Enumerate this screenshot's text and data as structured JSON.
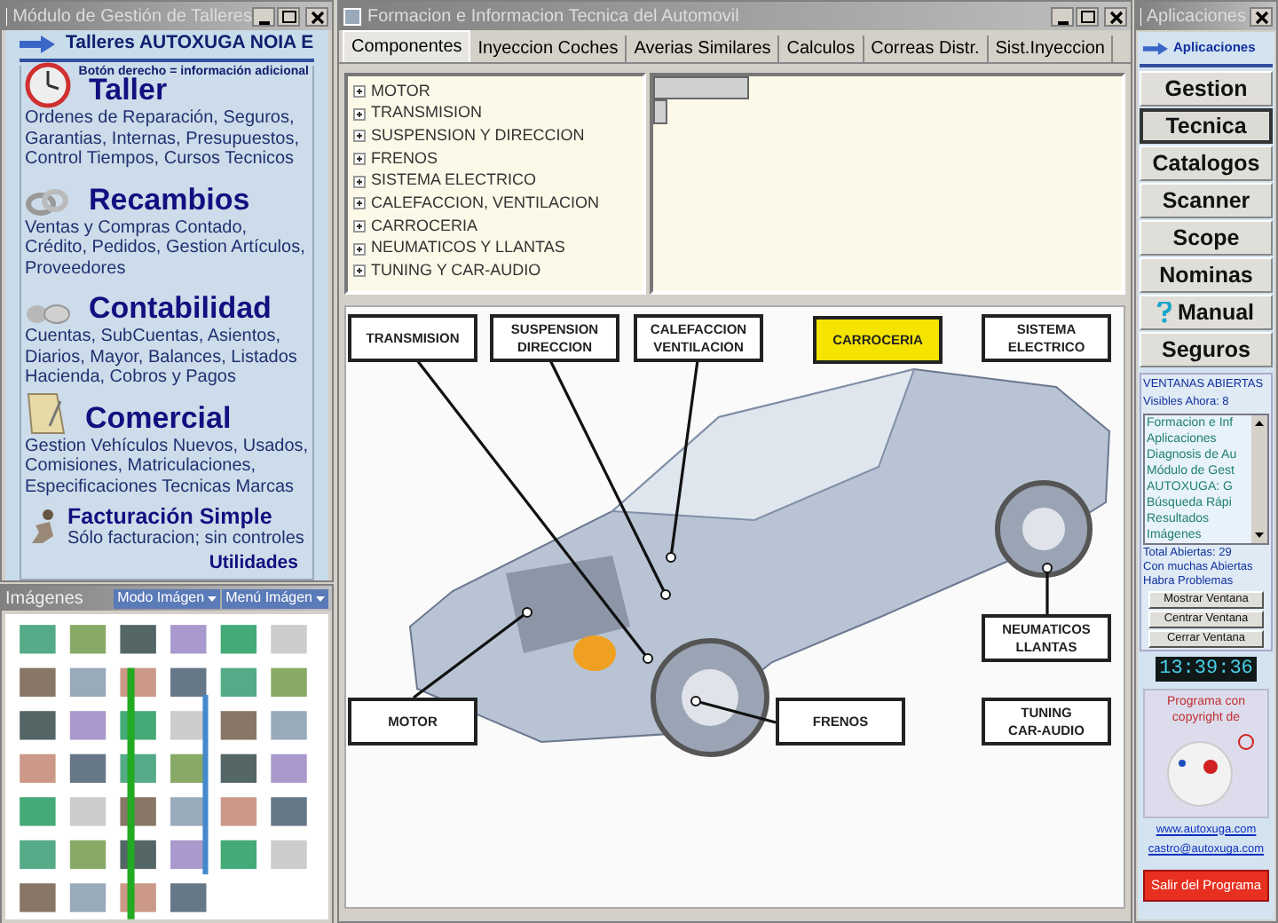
{
  "left_window": {
    "title": "Módulo de Gestión de Talleres",
    "header": "Talleres AUTOXUGA NOIA E",
    "hint": "Botón derecho = información adicional",
    "sections": [
      {
        "kind": "clock",
        "title": "Taller",
        "description": "Ordenes de Reparación, Seguros, Garantias, Internas, Presupuestos, Control Tiempos, Cursos Tecnicos"
      },
      {
        "kind": "rings",
        "title": "Recambios",
        "description": "Ventas y Compras Contado, Crédito, Pedidos,  Gestion Artículos, Proveedores"
      },
      {
        "kind": "coins",
        "title": "Contabilidad",
        "description": "Cuentas, SubCuentas, Asientos, Diarios, Mayor, Balances, Listados Hacienda, Cobros y Pagos"
      },
      {
        "kind": "notepad",
        "title": "Comercial",
        "description": "Gestion Vehículos Nuevos, Usados, Comisiones, Matriculaciones, Especificaciones Tecnicas Marcas"
      }
    ],
    "simple": {
      "title": "Facturación Simple",
      "description": "Sólo facturacion; sin controles"
    },
    "utilities": "Utilidades"
  },
  "images_window": {
    "title": "Imágenes",
    "buttons": [
      "Modo Imágen",
      "Menú Imágen"
    ]
  },
  "main_window": {
    "title": "Formacion e Informacion Tecnica del Automovil",
    "tabs": [
      {
        "label": "Componentes",
        "selected": true
      },
      {
        "label": "Inyeccion Coches",
        "selected": false
      },
      {
        "label": "Averias Similares",
        "selected": false
      },
      {
        "label": "Calculos",
        "selected": false
      },
      {
        "label": "Correas Distr.",
        "selected": false
      },
      {
        "label": "Sist.Inyeccion",
        "selected": false
      }
    ],
    "tree": [
      {
        "label": "MOTOR",
        "expanded": false
      },
      {
        "label": "TRANSMISION",
        "expanded": false
      },
      {
        "label": "SUSPENSION Y DIRECCION",
        "expanded": false
      },
      {
        "label": "FRENOS",
        "expanded": false
      },
      {
        "label": "SISTEMA ELECTRICO",
        "expanded": false
      },
      {
        "label": "CALEFACCION, VENTILACION",
        "expanded": false
      },
      {
        "label": "CARROCERIA",
        "expanded": false
      },
      {
        "label": "NEUMATICOS Y LLANTAS",
        "expanded": false
      },
      {
        "label": "TUNING Y CAR-AUDIO",
        "expanded": false
      }
    ],
    "diagram_labels": [
      {
        "label": "TRANSMISION",
        "highlighted": false
      },
      {
        "label": "SUSPENSION DIRECCION",
        "highlighted": false
      },
      {
        "label": "CALEFACCION VENTILACION",
        "highlighted": false
      },
      {
        "label": "CARROCERIA",
        "highlighted": true
      },
      {
        "label": "SISTEMA ELECTRICO",
        "highlighted": false
      },
      {
        "label": "NEUMATICOS LLANTAS",
        "highlighted": false
      },
      {
        "label": "MOTOR",
        "highlighted": false
      },
      {
        "label": "FRENOS",
        "highlighted": false
      },
      {
        "label": "TUNING CAR-AUDIO",
        "highlighted": false
      }
    ]
  },
  "apps_window": {
    "title": "Aplicaciones",
    "header": "Aplicaciones",
    "buttons": [
      {
        "label": "Gestion",
        "kind": "plain",
        "selected": false
      },
      {
        "label": "Tecnica",
        "kind": "plain",
        "selected": true
      },
      {
        "label": "Catalogos",
        "kind": "plain",
        "selected": false
      },
      {
        "label": "Scanner",
        "kind": "plain",
        "selected": false
      },
      {
        "label": "Scope",
        "kind": "plain",
        "selected": false
      },
      {
        "label": "Nominas",
        "kind": "plain",
        "selected": false
      },
      {
        "label": "Manual",
        "kind": "help",
        "selected": false
      },
      {
        "label": "Seguros",
        "kind": "plain",
        "selected": false
      }
    ],
    "open_windows": {
      "title": "VENTANAS ABIERTAS",
      "visible": "Visibles Ahora: 8",
      "items": [
        "Formacion e Inf",
        "Aplicaciones",
        "Diagnosis de Au",
        "Módulo de Gest",
        "AUTOXUGA:  G",
        "Búsqueda Rápi",
        "Resultados",
        "Imágenes"
      ],
      "total": "Total Abiertas: 29",
      "warning": [
        "Con muchas Abiertas",
        "Habra Problemas"
      ],
      "buttons": [
        "Mostrar Ventana",
        "Centrar Ventana",
        "Cerrar Ventana"
      ]
    },
    "clock": "13:39:36",
    "copyright": "Programa con copyright de",
    "links": [
      "www.autoxuga.com",
      "castro@autoxuga.com"
    ],
    "exit": "Salir del Programa"
  }
}
